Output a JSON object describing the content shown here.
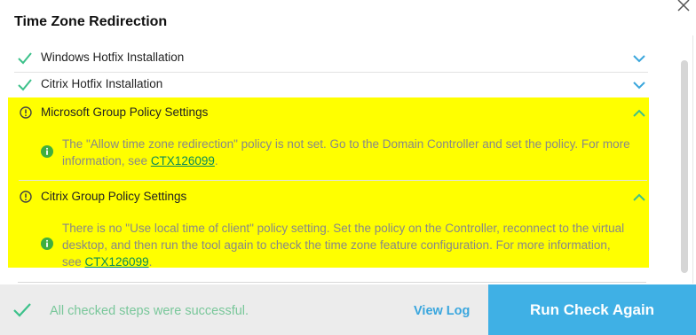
{
  "window": {
    "title": "Time Zone Redirection"
  },
  "steps": [
    {
      "label": "Windows Hotfix Installation",
      "status": "success",
      "icon": "check-icon",
      "expanded": false
    },
    {
      "label": "Citrix Hotfix Installation",
      "status": "success",
      "icon": "check-icon",
      "expanded": false
    }
  ],
  "sections": [
    {
      "label": "Microsoft Group Policy Settings",
      "status": "warning",
      "expanded": true,
      "message_text": "The \"Allow time zone redirection\" policy is not set. Go to the Domain Controller and set the policy. For more information, see ",
      "link": "CTX126099",
      "message_end": "."
    },
    {
      "label": "Citrix Group Policy Settings",
      "status": "warning",
      "expanded": true,
      "message_text": "There is no \"Use local time of client\" policy setting. Set the policy on the Controller, reconnect to the virtual desktop, and then run the tool again to check the time zone feature configuration. For more information, see ",
      "link": "CTX126099",
      "message_end": "."
    }
  ],
  "footer": {
    "status_text": "All checked steps were successful.",
    "view_log": "View Log",
    "run_again": "Run Check Again"
  },
  "colors": {
    "highlight": "#ffff00",
    "success_green": "#3cc18a",
    "accent_blue": "#3fb0e5",
    "link_green": "#0a8a57"
  }
}
